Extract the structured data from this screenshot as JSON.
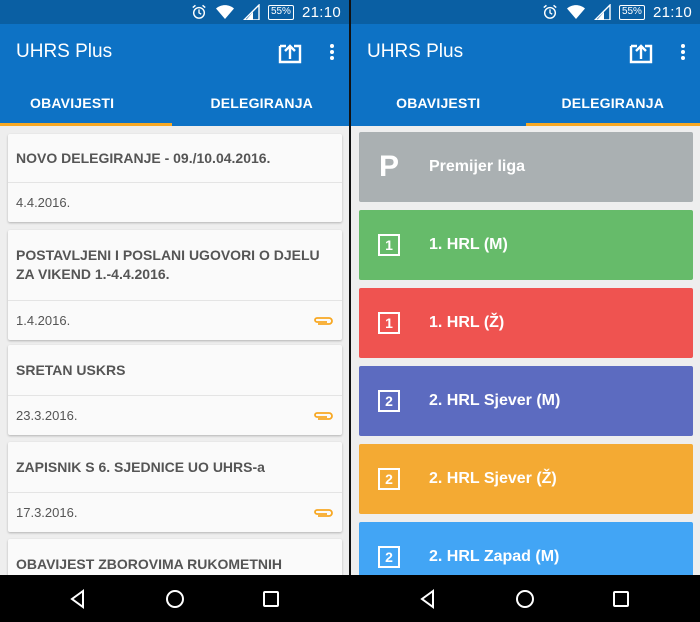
{
  "status": {
    "battery": "55%",
    "time": "21:10",
    "icons": [
      "alarm-icon",
      "wifi-icon",
      "signal-icon",
      "battery-icon"
    ]
  },
  "app": {
    "title": "UHRS Plus"
  },
  "tabs": [
    {
      "label": "OBAVIJESTI"
    },
    {
      "label": "DELEGIRANJA"
    }
  ],
  "left_tab_active": 0,
  "right_tab_active": 1,
  "news": [
    {
      "title": "NOVO DELEGIRANJE - 09./10.04.2016.",
      "date": "4.4.2016.",
      "attachment": false
    },
    {
      "title": "POSTAVLJENI I POSLANI UGOVORI O DJELU ZA VIKEND 1.-4.4.2016.",
      "date": "1.4.2016.",
      "attachment": true
    },
    {
      "title": "SRETAN USKRS",
      "date": "23.3.2016.",
      "attachment": true
    },
    {
      "title": "ZAPISNIK S 6. SJEDNICE UO UHRS-a",
      "date": "17.3.2016.",
      "attachment": true
    },
    {
      "title": "OBAVIJEST ZBOROVIMA RUKOMETNIH",
      "date": "",
      "attachment": false
    }
  ],
  "leagues": [
    {
      "name": "Premijer liga",
      "icon": "P",
      "color": "#aab0b2"
    },
    {
      "name": "1. HRL (M)",
      "icon": "1",
      "color": "#66bb6a"
    },
    {
      "name": "1. HRL (Ž)",
      "icon": "1",
      "color": "#ef5350"
    },
    {
      "name": "2. HRL Sjever (M)",
      "icon": "2",
      "color": "#5c6bc0"
    },
    {
      "name": "2. HRL Sjever (Ž)",
      "icon": "2",
      "color": "#f4aa33"
    },
    {
      "name": "2. HRL Zapad (M)",
      "icon": "2",
      "color": "#42a5f5"
    }
  ],
  "colors": {
    "statusbar": "#0a5fa3",
    "appbar": "#0d72c5",
    "tab_indicator": "#f7a823",
    "attachment": "#f7a823"
  }
}
